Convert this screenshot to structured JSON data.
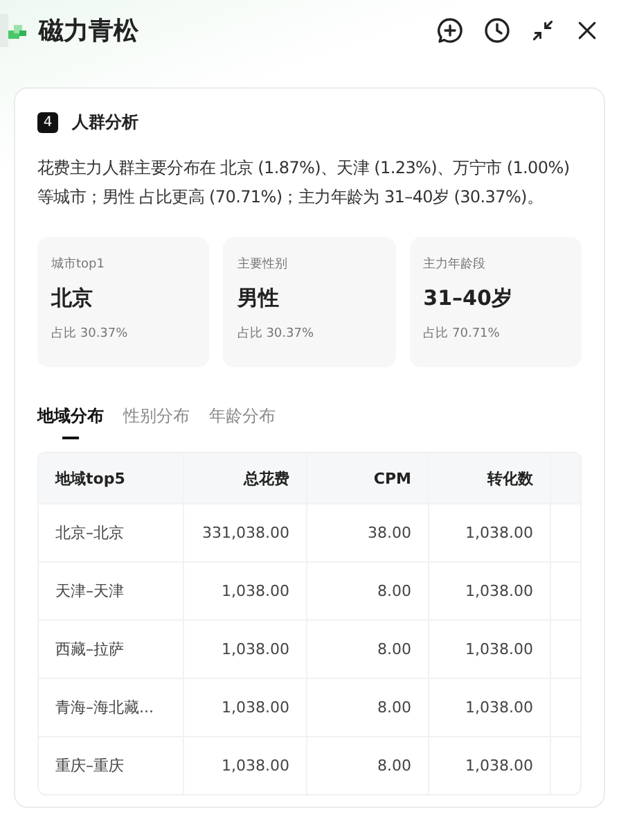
{
  "header": {
    "title": "磁力青松"
  },
  "section": {
    "number": "4",
    "title": "人群分析",
    "summary": "花费主力人群主要分布在 北京 (1.87%)、天津 (1.23%)、万宁市 (1.00%) 等城市；男性 占比更高 (70.71%)；主力年龄为 31–40岁 (30.37%)。"
  },
  "stats": [
    {
      "label": "城市top1",
      "value": "北京",
      "share": "占比 30.37%"
    },
    {
      "label": "主要性别",
      "value": "男性",
      "share": "占比 30.37%"
    },
    {
      "label": "主力年龄段",
      "value": "31–40岁",
      "share": "占比 70.71%"
    }
  ],
  "tabs": [
    {
      "label": "地域分布",
      "selected": true
    },
    {
      "label": "性别分布",
      "selected": false
    },
    {
      "label": "年龄分布",
      "selected": false
    }
  ],
  "table": {
    "columns": [
      "地域top5",
      "总花费",
      "CPM",
      "转化数"
    ],
    "rows": [
      [
        "北京–北京",
        "331,038.00",
        "38.00",
        "1,038.00"
      ],
      [
        "天津–天津",
        "1,038.00",
        "8.00",
        "1,038.00"
      ],
      [
        "西藏–拉萨",
        "1,038.00",
        "8.00",
        "1,038.00"
      ],
      [
        "青海–海北藏...",
        "1,038.00",
        "8.00",
        "1,038.00"
      ],
      [
        "重庆–重庆",
        "1,038.00",
        "8.00",
        "1,038.00"
      ]
    ]
  }
}
